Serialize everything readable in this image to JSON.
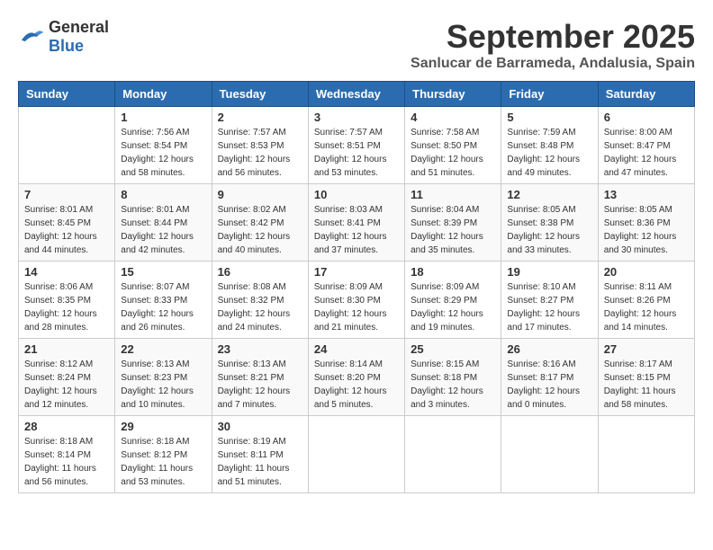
{
  "logo": {
    "general": "General",
    "blue": "Blue"
  },
  "title": {
    "month": "September 2025",
    "location": "Sanlucar de Barrameda, Andalusia, Spain"
  },
  "headers": [
    "Sunday",
    "Monday",
    "Tuesday",
    "Wednesday",
    "Thursday",
    "Friday",
    "Saturday"
  ],
  "weeks": [
    [
      {
        "day": "",
        "info": ""
      },
      {
        "day": "1",
        "info": "Sunrise: 7:56 AM\nSunset: 8:54 PM\nDaylight: 12 hours\nand 58 minutes."
      },
      {
        "day": "2",
        "info": "Sunrise: 7:57 AM\nSunset: 8:53 PM\nDaylight: 12 hours\nand 56 minutes."
      },
      {
        "day": "3",
        "info": "Sunrise: 7:57 AM\nSunset: 8:51 PM\nDaylight: 12 hours\nand 53 minutes."
      },
      {
        "day": "4",
        "info": "Sunrise: 7:58 AM\nSunset: 8:50 PM\nDaylight: 12 hours\nand 51 minutes."
      },
      {
        "day": "5",
        "info": "Sunrise: 7:59 AM\nSunset: 8:48 PM\nDaylight: 12 hours\nand 49 minutes."
      },
      {
        "day": "6",
        "info": "Sunrise: 8:00 AM\nSunset: 8:47 PM\nDaylight: 12 hours\nand 47 minutes."
      }
    ],
    [
      {
        "day": "7",
        "info": "Sunrise: 8:01 AM\nSunset: 8:45 PM\nDaylight: 12 hours\nand 44 minutes."
      },
      {
        "day": "8",
        "info": "Sunrise: 8:01 AM\nSunset: 8:44 PM\nDaylight: 12 hours\nand 42 minutes."
      },
      {
        "day": "9",
        "info": "Sunrise: 8:02 AM\nSunset: 8:42 PM\nDaylight: 12 hours\nand 40 minutes."
      },
      {
        "day": "10",
        "info": "Sunrise: 8:03 AM\nSunset: 8:41 PM\nDaylight: 12 hours\nand 37 minutes."
      },
      {
        "day": "11",
        "info": "Sunrise: 8:04 AM\nSunset: 8:39 PM\nDaylight: 12 hours\nand 35 minutes."
      },
      {
        "day": "12",
        "info": "Sunrise: 8:05 AM\nSunset: 8:38 PM\nDaylight: 12 hours\nand 33 minutes."
      },
      {
        "day": "13",
        "info": "Sunrise: 8:05 AM\nSunset: 8:36 PM\nDaylight: 12 hours\nand 30 minutes."
      }
    ],
    [
      {
        "day": "14",
        "info": "Sunrise: 8:06 AM\nSunset: 8:35 PM\nDaylight: 12 hours\nand 28 minutes."
      },
      {
        "day": "15",
        "info": "Sunrise: 8:07 AM\nSunset: 8:33 PM\nDaylight: 12 hours\nand 26 minutes."
      },
      {
        "day": "16",
        "info": "Sunrise: 8:08 AM\nSunset: 8:32 PM\nDaylight: 12 hours\nand 24 minutes."
      },
      {
        "day": "17",
        "info": "Sunrise: 8:09 AM\nSunset: 8:30 PM\nDaylight: 12 hours\nand 21 minutes."
      },
      {
        "day": "18",
        "info": "Sunrise: 8:09 AM\nSunset: 8:29 PM\nDaylight: 12 hours\nand 19 minutes."
      },
      {
        "day": "19",
        "info": "Sunrise: 8:10 AM\nSunset: 8:27 PM\nDaylight: 12 hours\nand 17 minutes."
      },
      {
        "day": "20",
        "info": "Sunrise: 8:11 AM\nSunset: 8:26 PM\nDaylight: 12 hours\nand 14 minutes."
      }
    ],
    [
      {
        "day": "21",
        "info": "Sunrise: 8:12 AM\nSunset: 8:24 PM\nDaylight: 12 hours\nand 12 minutes."
      },
      {
        "day": "22",
        "info": "Sunrise: 8:13 AM\nSunset: 8:23 PM\nDaylight: 12 hours\nand 10 minutes."
      },
      {
        "day": "23",
        "info": "Sunrise: 8:13 AM\nSunset: 8:21 PM\nDaylight: 12 hours\nand 7 minutes."
      },
      {
        "day": "24",
        "info": "Sunrise: 8:14 AM\nSunset: 8:20 PM\nDaylight: 12 hours\nand 5 minutes."
      },
      {
        "day": "25",
        "info": "Sunrise: 8:15 AM\nSunset: 8:18 PM\nDaylight: 12 hours\nand 3 minutes."
      },
      {
        "day": "26",
        "info": "Sunrise: 8:16 AM\nSunset: 8:17 PM\nDaylight: 12 hours\nand 0 minutes."
      },
      {
        "day": "27",
        "info": "Sunrise: 8:17 AM\nSunset: 8:15 PM\nDaylight: 11 hours\nand 58 minutes."
      }
    ],
    [
      {
        "day": "28",
        "info": "Sunrise: 8:18 AM\nSunset: 8:14 PM\nDaylight: 11 hours\nand 56 minutes."
      },
      {
        "day": "29",
        "info": "Sunrise: 8:18 AM\nSunset: 8:12 PM\nDaylight: 11 hours\nand 53 minutes."
      },
      {
        "day": "30",
        "info": "Sunrise: 8:19 AM\nSunset: 8:11 PM\nDaylight: 11 hours\nand 51 minutes."
      },
      {
        "day": "",
        "info": ""
      },
      {
        "day": "",
        "info": ""
      },
      {
        "day": "",
        "info": ""
      },
      {
        "day": "",
        "info": ""
      }
    ]
  ]
}
